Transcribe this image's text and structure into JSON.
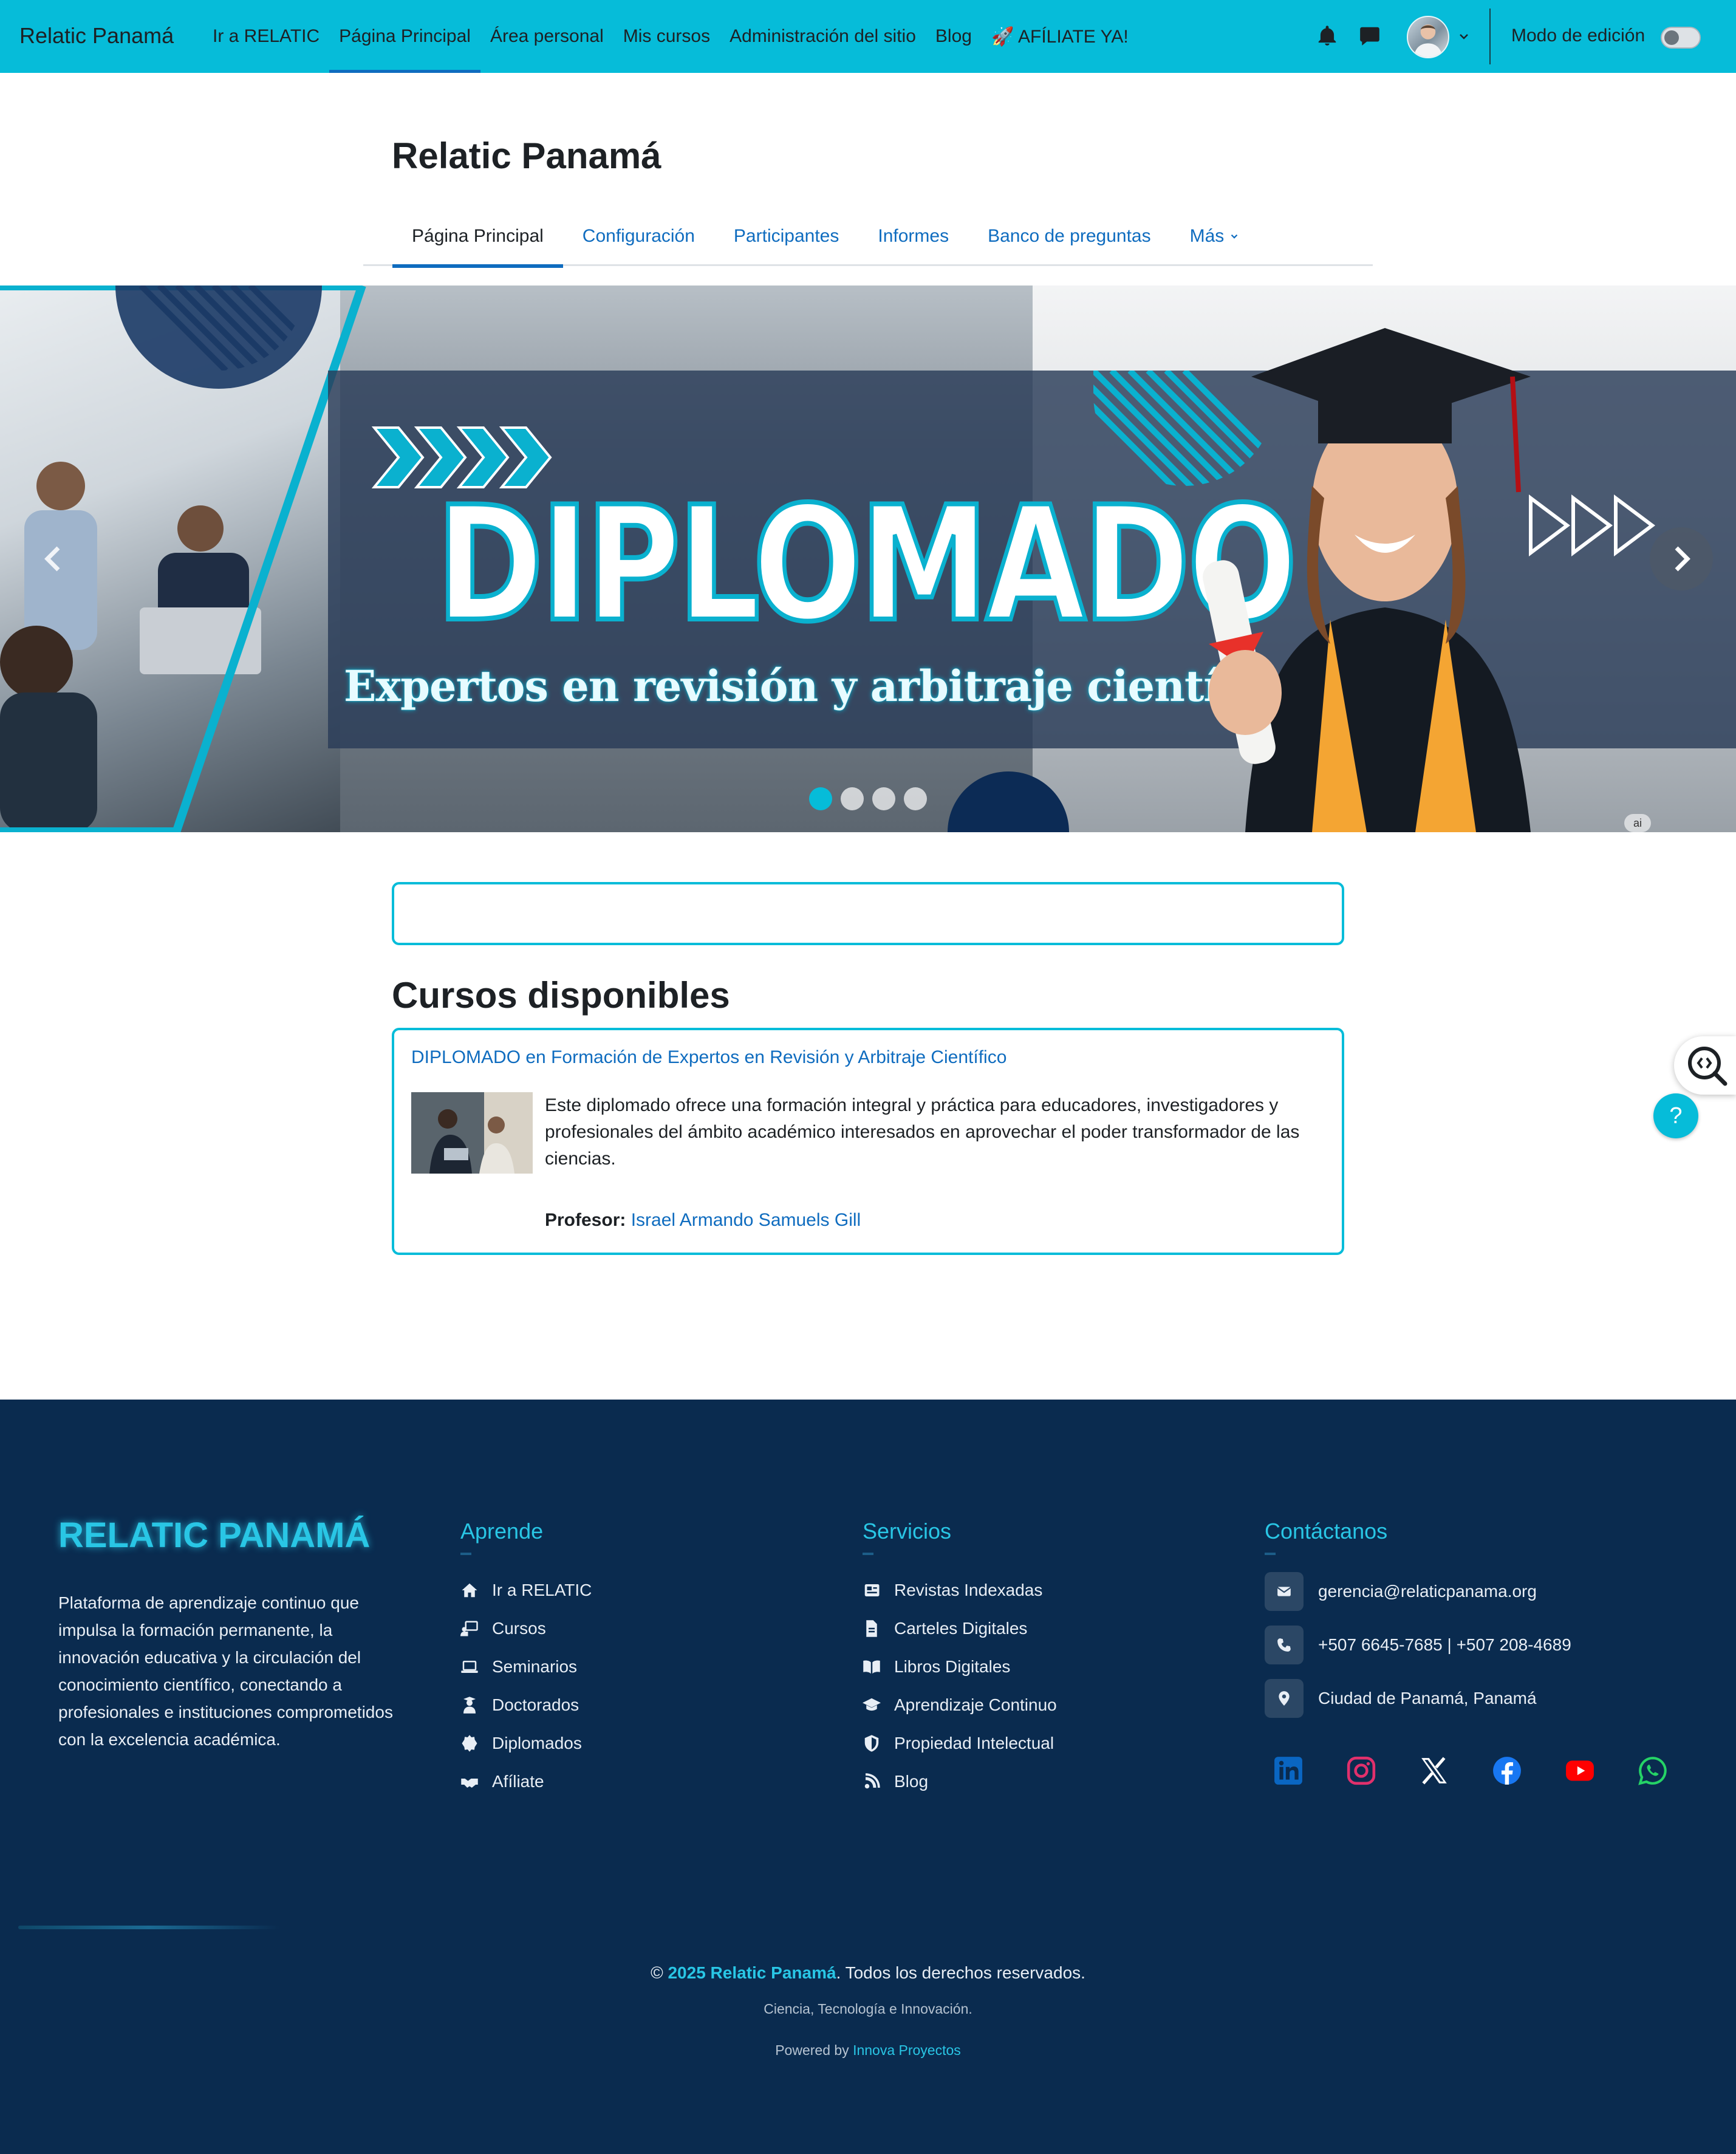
{
  "navbar": {
    "brand": "Relatic Panamá",
    "items": [
      {
        "label": "Ir a RELATIC"
      },
      {
        "label": "Página Principal",
        "active": true
      },
      {
        "label": "Área personal"
      },
      {
        "label": "Mis cursos"
      },
      {
        "label": "Administración del sitio"
      },
      {
        "label": "Blog"
      },
      {
        "label": "🚀 AFÍLIATE YA!"
      }
    ],
    "edit_mode_label": "Modo de edición",
    "edit_mode_on": false,
    "icons": [
      "bell-icon",
      "chat-icon",
      "avatar",
      "chevron-down-icon"
    ],
    "bg_color": "#06bcd9"
  },
  "course_header": {
    "title": "Relatic Panamá",
    "tabs": [
      {
        "label": "Página Principal",
        "active": true
      },
      {
        "label": "Configuración"
      },
      {
        "label": "Participantes"
      },
      {
        "label": "Informes"
      },
      {
        "label": "Banco de preguntas"
      },
      {
        "label": "Más"
      }
    ]
  },
  "banner": {
    "title": "DIPLOMADO",
    "subtitle": "Expertos en revisión y arbitraje científico",
    "slide_count": 4,
    "active_slide": 1,
    "badge": "ai"
  },
  "courses": {
    "section_title": "Cursos disponibles",
    "items": [
      {
        "name": "DIPLOMADO en Formación de Expertos en Revisión y Arbitraje Científico",
        "summary": "Este diplomado ofrece una formación integral y práctica para educadores, investigadores y profesionales del ámbito académico interesados en aprovechar el poder transformador de las ciencias.",
        "teacher_label": "Profesor:",
        "teacher_name": "Israel Armando Samuels Gill"
      }
    ]
  },
  "floating": {
    "help_label": "?"
  },
  "footer": {
    "logo": "RELATIC PANAMÁ",
    "description": "Plataforma de aprendizaje continuo que impulsa la formación permanente, la innovación educativa y la circulación del conocimiento científico, conectando a profesionales e instituciones comprometidos con la excelencia académica.",
    "learn": {
      "title": "Aprende",
      "items": [
        {
          "label": "Ir a RELATIC",
          "icon": "home-icon"
        },
        {
          "label": "Cursos",
          "icon": "chalkboard-teacher-icon"
        },
        {
          "label": "Seminarios",
          "icon": "laptop-icon"
        },
        {
          "label": "Doctorados",
          "icon": "user-graduate-icon"
        },
        {
          "label": "Diplomados",
          "icon": "certificate-icon"
        },
        {
          "label": "Afíliate",
          "icon": "handshake-icon"
        }
      ]
    },
    "services": {
      "title": "Servicios",
      "items": [
        {
          "label": "Revistas Indexadas",
          "icon": "newspaper-icon"
        },
        {
          "label": "Carteles Digitales",
          "icon": "file-icon"
        },
        {
          "label": "Libros Digitales",
          "icon": "book-open-icon"
        },
        {
          "label": "Aprendizaje Continuo",
          "icon": "graduation-cap-icon"
        },
        {
          "label": "Propiedad Intelectual",
          "icon": "shield-icon"
        },
        {
          "label": "Blog",
          "icon": "blog-icon"
        }
      ]
    },
    "contact": {
      "title": "Contáctanos",
      "email": "gerencia@relaticpanama.org",
      "phone": "+507 6645-7685 | +507 208-4689",
      "location": "Ciudad de Panamá, Panamá"
    },
    "socials": [
      {
        "name": "linkedin-icon",
        "color": "#0a66c2"
      },
      {
        "name": "instagram-icon",
        "color": "#e1306c"
      },
      {
        "name": "x-icon",
        "color": "#ffffff"
      },
      {
        "name": "facebook-icon",
        "color": "#1877f2"
      },
      {
        "name": "youtube-icon",
        "color": "#ff0000"
      },
      {
        "name": "whatsapp-icon",
        "color": "#25d366"
      }
    ],
    "copyright_prefix": "© ",
    "copyright_highlight": "2025 Relatic Panamá",
    "copyright_suffix": ". Todos los derechos reservados.",
    "tagline": "Ciencia, Tecnología e Innovación.",
    "powered_prefix": "Powered by ",
    "powered_link": "Innova Proyectos",
    "bg_color": "#0a2b4f",
    "accent_color": "#29c6e5"
  }
}
